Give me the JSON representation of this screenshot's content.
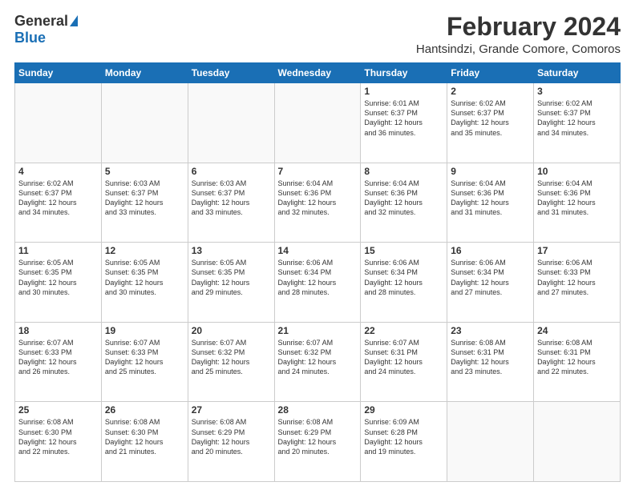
{
  "logo": {
    "general": "General",
    "blue": "Blue"
  },
  "header": {
    "title": "February 2024",
    "subtitle": "Hantsindzi, Grande Comore, Comoros"
  },
  "days_of_week": [
    "Sunday",
    "Monday",
    "Tuesday",
    "Wednesday",
    "Thursday",
    "Friday",
    "Saturday"
  ],
  "weeks": [
    [
      {
        "day": "",
        "info": ""
      },
      {
        "day": "",
        "info": ""
      },
      {
        "day": "",
        "info": ""
      },
      {
        "day": "",
        "info": ""
      },
      {
        "day": "1",
        "info": "Sunrise: 6:01 AM\nSunset: 6:37 PM\nDaylight: 12 hours\nand 36 minutes."
      },
      {
        "day": "2",
        "info": "Sunrise: 6:02 AM\nSunset: 6:37 PM\nDaylight: 12 hours\nand 35 minutes."
      },
      {
        "day": "3",
        "info": "Sunrise: 6:02 AM\nSunset: 6:37 PM\nDaylight: 12 hours\nand 34 minutes."
      }
    ],
    [
      {
        "day": "4",
        "info": "Sunrise: 6:02 AM\nSunset: 6:37 PM\nDaylight: 12 hours\nand 34 minutes."
      },
      {
        "day": "5",
        "info": "Sunrise: 6:03 AM\nSunset: 6:37 PM\nDaylight: 12 hours\nand 33 minutes."
      },
      {
        "day": "6",
        "info": "Sunrise: 6:03 AM\nSunset: 6:37 PM\nDaylight: 12 hours\nand 33 minutes."
      },
      {
        "day": "7",
        "info": "Sunrise: 6:04 AM\nSunset: 6:36 PM\nDaylight: 12 hours\nand 32 minutes."
      },
      {
        "day": "8",
        "info": "Sunrise: 6:04 AM\nSunset: 6:36 PM\nDaylight: 12 hours\nand 32 minutes."
      },
      {
        "day": "9",
        "info": "Sunrise: 6:04 AM\nSunset: 6:36 PM\nDaylight: 12 hours\nand 31 minutes."
      },
      {
        "day": "10",
        "info": "Sunrise: 6:04 AM\nSunset: 6:36 PM\nDaylight: 12 hours\nand 31 minutes."
      }
    ],
    [
      {
        "day": "11",
        "info": "Sunrise: 6:05 AM\nSunset: 6:35 PM\nDaylight: 12 hours\nand 30 minutes."
      },
      {
        "day": "12",
        "info": "Sunrise: 6:05 AM\nSunset: 6:35 PM\nDaylight: 12 hours\nand 30 minutes."
      },
      {
        "day": "13",
        "info": "Sunrise: 6:05 AM\nSunset: 6:35 PM\nDaylight: 12 hours\nand 29 minutes."
      },
      {
        "day": "14",
        "info": "Sunrise: 6:06 AM\nSunset: 6:34 PM\nDaylight: 12 hours\nand 28 minutes."
      },
      {
        "day": "15",
        "info": "Sunrise: 6:06 AM\nSunset: 6:34 PM\nDaylight: 12 hours\nand 28 minutes."
      },
      {
        "day": "16",
        "info": "Sunrise: 6:06 AM\nSunset: 6:34 PM\nDaylight: 12 hours\nand 27 minutes."
      },
      {
        "day": "17",
        "info": "Sunrise: 6:06 AM\nSunset: 6:33 PM\nDaylight: 12 hours\nand 27 minutes."
      }
    ],
    [
      {
        "day": "18",
        "info": "Sunrise: 6:07 AM\nSunset: 6:33 PM\nDaylight: 12 hours\nand 26 minutes."
      },
      {
        "day": "19",
        "info": "Sunrise: 6:07 AM\nSunset: 6:33 PM\nDaylight: 12 hours\nand 25 minutes."
      },
      {
        "day": "20",
        "info": "Sunrise: 6:07 AM\nSunset: 6:32 PM\nDaylight: 12 hours\nand 25 minutes."
      },
      {
        "day": "21",
        "info": "Sunrise: 6:07 AM\nSunset: 6:32 PM\nDaylight: 12 hours\nand 24 minutes."
      },
      {
        "day": "22",
        "info": "Sunrise: 6:07 AM\nSunset: 6:31 PM\nDaylight: 12 hours\nand 24 minutes."
      },
      {
        "day": "23",
        "info": "Sunrise: 6:08 AM\nSunset: 6:31 PM\nDaylight: 12 hours\nand 23 minutes."
      },
      {
        "day": "24",
        "info": "Sunrise: 6:08 AM\nSunset: 6:31 PM\nDaylight: 12 hours\nand 22 minutes."
      }
    ],
    [
      {
        "day": "25",
        "info": "Sunrise: 6:08 AM\nSunset: 6:30 PM\nDaylight: 12 hours\nand 22 minutes."
      },
      {
        "day": "26",
        "info": "Sunrise: 6:08 AM\nSunset: 6:30 PM\nDaylight: 12 hours\nand 21 minutes."
      },
      {
        "day": "27",
        "info": "Sunrise: 6:08 AM\nSunset: 6:29 PM\nDaylight: 12 hours\nand 20 minutes."
      },
      {
        "day": "28",
        "info": "Sunrise: 6:08 AM\nSunset: 6:29 PM\nDaylight: 12 hours\nand 20 minutes."
      },
      {
        "day": "29",
        "info": "Sunrise: 6:09 AM\nSunset: 6:28 PM\nDaylight: 12 hours\nand 19 minutes."
      },
      {
        "day": "",
        "info": ""
      },
      {
        "day": "",
        "info": ""
      }
    ]
  ]
}
